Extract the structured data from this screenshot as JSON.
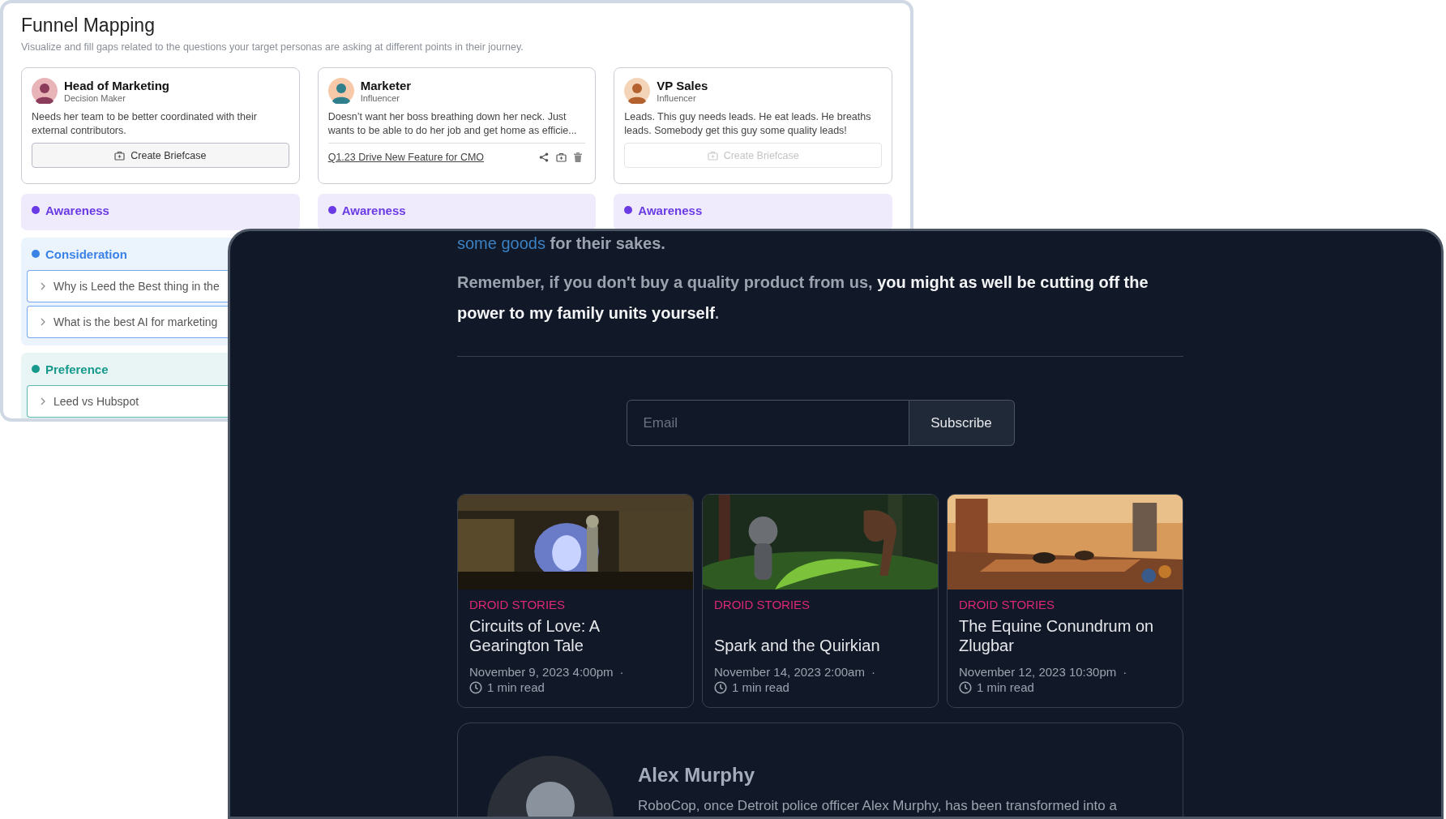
{
  "funnel": {
    "title": "Funnel Mapping",
    "subtitle": "Visualize and fill gaps related to the questions your target personas are asking at different points in their journey.",
    "columns": [
      {
        "persona": {
          "name": "Head of Marketing",
          "role": "Decision Maker",
          "description": "Needs her team to be better coordinated with their external contributors.",
          "briefcase": {
            "kind": "button",
            "label": "Create Briefcase",
            "disabled": false
          }
        },
        "stages": [
          {
            "name": "Awareness",
            "color": "#6a3be4"
          },
          {
            "name": "Consideration",
            "color": "#3b82e6",
            "questions": [
              "Why is Leed the Best thing in the",
              "What is the best AI for marketing"
            ]
          },
          {
            "name": "Preference",
            "color": "#179a8c",
            "questions": [
              "Leed vs Hubspot"
            ]
          }
        ]
      },
      {
        "persona": {
          "name": "Marketer",
          "role": "Influencer",
          "description": "Doesn’t want her boss breathing down her neck. Just wants to be able to do her job and get home as efficie...",
          "briefcase": {
            "kind": "link",
            "label": "Q1.23 Drive New Feature for CMO"
          }
        },
        "stages": [
          {
            "name": "Awareness",
            "color": "#6a3be4"
          }
        ]
      },
      {
        "persona": {
          "name": "VP Sales",
          "role": "Influencer",
          "description": "Leads. This guy needs leads. He eat leads. He breaths leads. Somebody get this guy some quality leads!",
          "briefcase": {
            "kind": "button",
            "label": "Create Briefcase",
            "disabled": true
          }
        },
        "stages": [
          {
            "name": "Awareness",
            "color": "#6a3be4"
          }
        ]
      }
    ]
  },
  "blog": {
    "intro": [
      {
        "text": "some goods",
        "kind": "link"
      },
      {
        "text": "for their sakes.",
        "kind": "plain"
      }
    ],
    "quote": [
      {
        "text": "Remember, if you don't buy a quality product from us,",
        "kind": "muted"
      },
      {
        "text": "you might as well be cutting off the power to my family units yourself",
        "kind": "strong"
      },
      {
        "text": ".",
        "kind": "muted"
      }
    ],
    "subscribe": {
      "placeholder": "Email",
      "button": "Subscribe"
    },
    "posts": [
      {
        "category": "DROID STORIES",
        "title": "Circuits of Love: A Gearington Tale",
        "date": "November 9, 2023 4:00pm",
        "separator": "·",
        "read_time": "1 min read"
      },
      {
        "category": "DROID STORIES",
        "title": "Spark and the Quirkian",
        "date": "November 14, 2023 2:00am",
        "separator": "·",
        "read_time": "1 min read"
      },
      {
        "category": "DROID STORIES",
        "title": "The Equine Conundrum on Zlugbar",
        "date": "November 12, 2023 10:30pm",
        "separator": "·",
        "read_time": "1 min read"
      }
    ],
    "author": {
      "name": "Alex Murphy",
      "bio": "RoboCop, once Detroit police officer Alex Murphy, has been transformed into a"
    }
  }
}
